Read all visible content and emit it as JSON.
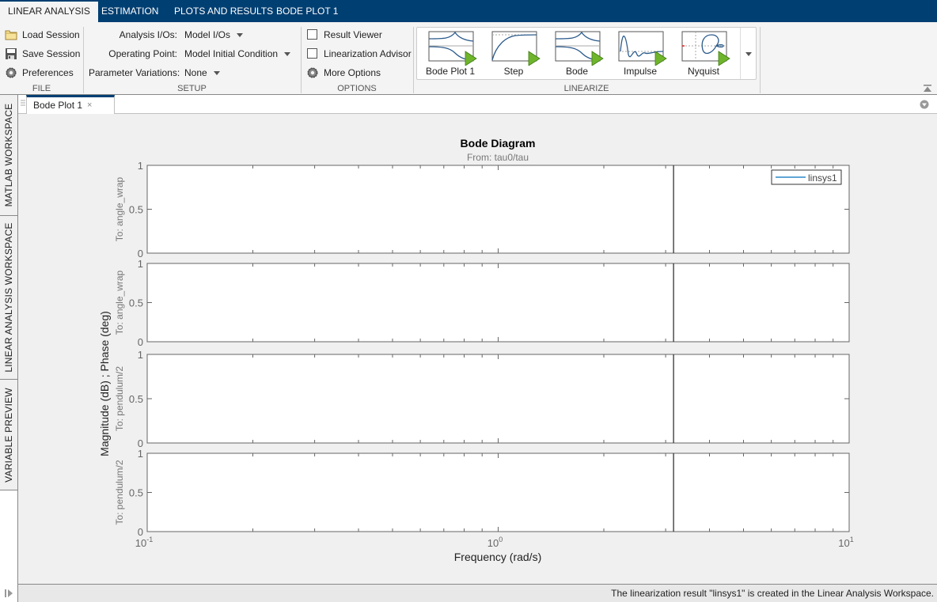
{
  "tabs": [
    {
      "label": "LINEAR ANALYSIS",
      "active": true
    },
    {
      "label": "ESTIMATION",
      "active": false
    },
    {
      "label": "PLOTS AND RESULTS",
      "active": false
    },
    {
      "label": "BODE PLOT 1",
      "active": false
    }
  ],
  "ribbon": {
    "file": {
      "label": "FILE",
      "load_session": "Load Session",
      "save_session": "Save Session",
      "preferences": "Preferences"
    },
    "setup": {
      "label": "SETUP",
      "analysis_ios_label": "Analysis I/Os:",
      "analysis_ios_value": "Model I/Os",
      "operating_point_label": "Operating Point:",
      "operating_point_value": "Model Initial Condition",
      "parameter_variations_label": "Parameter Variations:",
      "parameter_variations_value": "None"
    },
    "options": {
      "label": "OPTIONS",
      "result_viewer": "Result Viewer",
      "result_viewer_checked": false,
      "linearization_advisor": "Linearization Advisor",
      "linearization_advisor_checked": false,
      "more_options": "More Options"
    },
    "linearize": {
      "label": "LINEARIZE",
      "items": [
        {
          "label": "Bode Plot 1",
          "icon": "bode-plot-icon"
        },
        {
          "label": "Step",
          "icon": "step-plot-icon"
        },
        {
          "label": "Bode",
          "icon": "bode-plot-icon"
        },
        {
          "label": "Impulse",
          "icon": "impulse-plot-icon"
        },
        {
          "label": "Nyquist",
          "icon": "nyquist-plot-icon"
        }
      ]
    }
  },
  "sidebar": {
    "tabs": [
      "MATLAB WORKSPACE",
      "LINEAR ANALYSIS WORKSPACE",
      "VARIABLE PREVIEW"
    ]
  },
  "document": {
    "tab_label": "Bode Plot 1",
    "close_glyph": "×"
  },
  "status": {
    "message": "The linearization result \"linsys1\" is created in the Linear Analysis Workspace."
  },
  "colors": {
    "tabstrip": "#003f72",
    "series_line": "#0072bd",
    "play_green": "#6fb52c"
  },
  "chart_data": {
    "type": "line",
    "title": "Bode Diagram",
    "subtitle": "From: tau0/tau",
    "xlabel": "Frequency  (rad/s)",
    "ylabel": "Magnitude (dB) ; Phase (deg)",
    "xscale": "log",
    "xlim": [
      0.1,
      10
    ],
    "xticks": [
      {
        "value": 0.1,
        "base": "10",
        "exp": "-1"
      },
      {
        "value": 1,
        "base": "10",
        "exp": "0"
      },
      {
        "value": 10,
        "base": "10",
        "exp": "1"
      }
    ],
    "legend": {
      "entries": [
        "linsys1"
      ],
      "location": "top-right"
    },
    "vertical_marker_x": 3.16,
    "grid": false,
    "panels": [
      {
        "row_label": "To: angle_wrap",
        "kind": "magnitude",
        "ylim": [
          0,
          1
        ],
        "yticks": [
          "0",
          "0.5",
          "1"
        ]
      },
      {
        "row_label": "To: angle_wrap",
        "kind": "phase",
        "ylim": [
          0,
          1
        ],
        "yticks": [
          "0",
          "0.5",
          "1"
        ]
      },
      {
        "row_label": "To: pendulum/2",
        "kind": "magnitude",
        "ylim": [
          0,
          1
        ],
        "yticks": [
          "0",
          "0.5",
          "1"
        ]
      },
      {
        "row_label": "To: pendulum/2",
        "kind": "phase",
        "ylim": [
          0,
          1
        ],
        "yticks": [
          "0",
          "0.5",
          "1"
        ]
      }
    ],
    "series": [
      {
        "name": "linsys1",
        "values": []
      }
    ]
  }
}
